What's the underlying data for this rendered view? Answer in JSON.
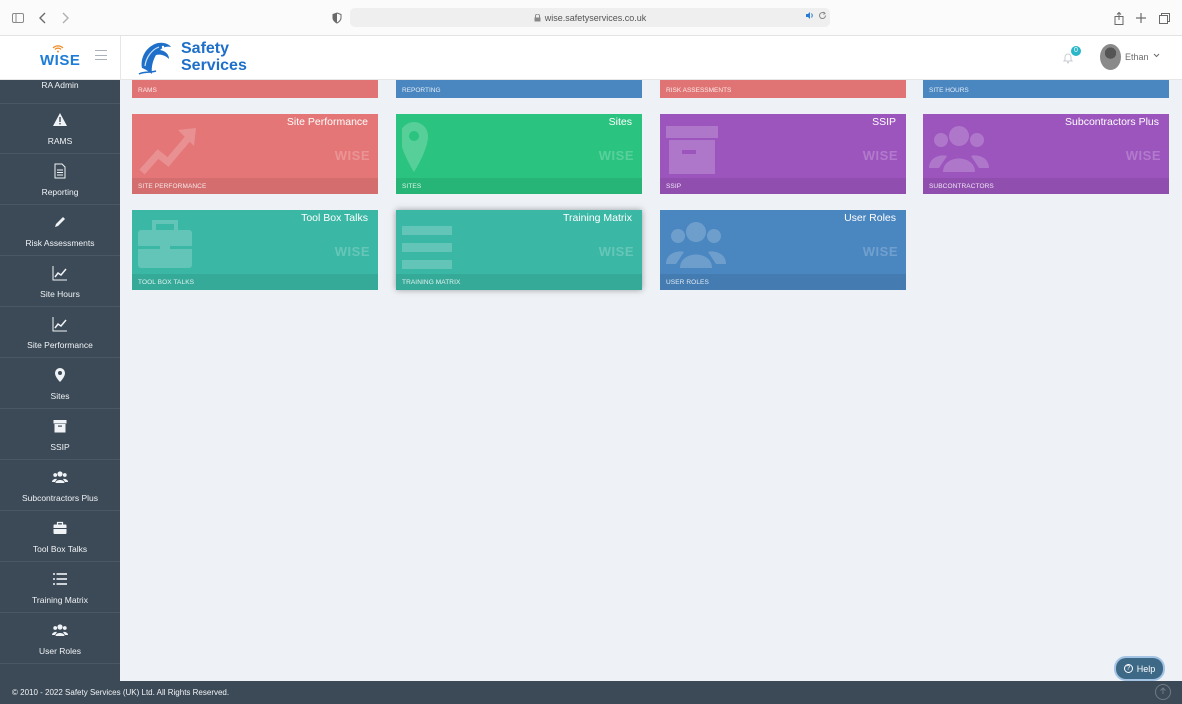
{
  "browser": {
    "url": "wise.safetyservices.co.uk"
  },
  "header": {
    "app_logo_text": "WISE",
    "brand_line1": "Safety",
    "brand_line2": "Services",
    "notification_count": "0",
    "user_name": "Ethan"
  },
  "sidebar": {
    "top_label": "RA Admin",
    "items": [
      {
        "label": "RAMS",
        "icon": "warning-icon"
      },
      {
        "label": "Reporting",
        "icon": "document-icon"
      },
      {
        "label": "Risk Assessments",
        "icon": "pencil-icon"
      },
      {
        "label": "Site Hours",
        "icon": "line-chart-icon"
      },
      {
        "label": "Site Performance",
        "icon": "line-chart-icon"
      },
      {
        "label": "Sites",
        "icon": "map-marker-icon"
      },
      {
        "label": "SSIP",
        "icon": "archive-icon"
      },
      {
        "label": "Subcontractors Plus",
        "icon": "users-icon"
      },
      {
        "label": "Tool Box Talks",
        "icon": "briefcase-icon"
      },
      {
        "label": "Training Matrix",
        "icon": "list-icon"
      },
      {
        "label": "User Roles",
        "icon": "users-icon"
      }
    ]
  },
  "tiles_partial": [
    {
      "footer": "RAMS",
      "color": "#e07474"
    },
    {
      "footer": "REPORTING",
      "color": "#4a86c0"
    },
    {
      "footer": "RISK ASSESSMENTS",
      "color": "#e07474"
    },
    {
      "footer": "SITE HOURS",
      "color": "#4a86c0"
    }
  ],
  "tiles": [
    {
      "title": "Site Performance",
      "footer": "SITE PERFORMANCE",
      "color": "#e47677",
      "icon": "trend-arrow-icon"
    },
    {
      "title": "Sites",
      "footer": "SITES",
      "color": "#2bc380",
      "icon": "map-marker-icon"
    },
    {
      "title": "SSIP",
      "footer": "SSIP",
      "color": "#9b55bd",
      "icon": "archive-icon"
    },
    {
      "title": "Subcontractors Plus",
      "footer": "SUBCONTRACTORS",
      "color": "#9b55bd",
      "icon": "users-icon"
    },
    {
      "title": "Tool Box Talks",
      "footer": "TOOL BOX TALKS",
      "color": "#3bb7a5",
      "icon": "briefcase-icon"
    },
    {
      "title": "Training Matrix",
      "footer": "TRAINING MATRIX",
      "color": "#3bb7a5",
      "icon": "list-icon"
    },
    {
      "title": "User Roles",
      "footer": "USER ROLES",
      "color": "#4a86c0",
      "icon": "users-icon"
    }
  ],
  "tile_watermark": "WISE",
  "footer": {
    "copyright": "© 2010 - 2022 Safety Services (UK) Ltd. All Rights Reserved."
  },
  "help_label": "Help"
}
